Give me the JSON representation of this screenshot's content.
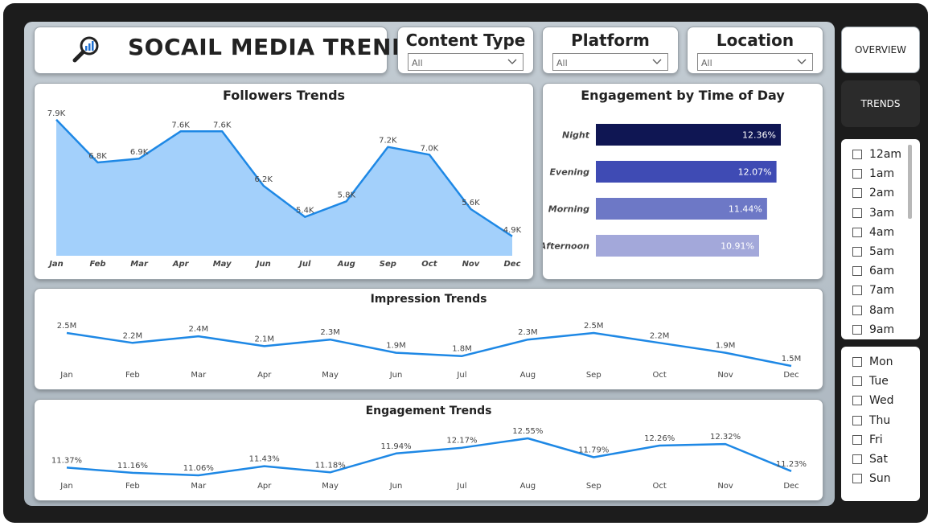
{
  "header": {
    "title": "SOCAIL MEDIA TRENDS",
    "icon": "magnifier-chart-icon"
  },
  "slicers": [
    {
      "label": "Content Type",
      "value": "All"
    },
    {
      "label": "Platform",
      "value": "All"
    },
    {
      "label": "Location",
      "value": "All"
    }
  ],
  "nav": {
    "overview": "OVERVIEW",
    "trends": "TRENDS"
  },
  "hours": [
    "12am",
    "1am",
    "2am",
    "3am",
    "4am",
    "5am",
    "6am",
    "7am",
    "8am",
    "9am"
  ],
  "days": [
    "Mon",
    "Tue",
    "Wed",
    "Thu",
    "Fri",
    "Sat",
    "Sun"
  ],
  "colors": {
    "line": "#1e88e5",
    "area": "#a3d0fb",
    "night": "#0f1653",
    "evening": "#3f4bb4",
    "morning": "#6d78c6",
    "afternoon": "#a3a8da"
  },
  "chart_data": [
    {
      "type": "area",
      "title": "Followers Trends",
      "categories": [
        "Jan",
        "Feb",
        "Mar",
        "Apr",
        "May",
        "Jun",
        "Jul",
        "Aug",
        "Sep",
        "Oct",
        "Nov",
        "Dec"
      ],
      "values": [
        7.9,
        6.8,
        6.9,
        7.6,
        7.6,
        6.2,
        5.4,
        5.8,
        7.2,
        7.0,
        5.6,
        4.9
      ],
      "labels": [
        "7.9K",
        "6.8K",
        "6.9K",
        "7.6K",
        "7.6K",
        "6.2K",
        "5.4K",
        "5.8K",
        "7.2K",
        "7.0K",
        "5.6K",
        "4.9K"
      ],
      "unit": "K",
      "ylim": [
        4.4,
        8.0
      ],
      "grid": false
    },
    {
      "type": "bar",
      "orientation": "horizontal",
      "title": "Engagement by Time of Day",
      "categories": [
        "Night",
        "Evening",
        "Morning",
        "Afternoon"
      ],
      "values": [
        12.36,
        12.07,
        11.44,
        10.91
      ],
      "labels": [
        "12.36%",
        "12.07%",
        "11.44%",
        "10.91%"
      ],
      "xlim": [
        0,
        12.36
      ]
    },
    {
      "type": "line",
      "title": "Impression Trends",
      "categories": [
        "Jan",
        "Feb",
        "Mar",
        "Apr",
        "May",
        "Jun",
        "Jul",
        "Aug",
        "Sep",
        "Oct",
        "Nov",
        "Dec"
      ],
      "values": [
        2.5,
        2.2,
        2.4,
        2.1,
        2.3,
        1.9,
        1.8,
        2.3,
        2.5,
        2.2,
        1.9,
        1.5
      ],
      "labels": [
        "2.5M",
        "2.2M",
        "2.4M",
        "2.1M",
        "2.3M",
        "1.9M",
        "1.8M",
        "2.3M",
        "2.5M",
        "2.2M",
        "1.9M",
        "1.5M"
      ],
      "unit": "M",
      "ylim": [
        1.5,
        2.5
      ]
    },
    {
      "type": "line",
      "title": "Engagement Trends",
      "categories": [
        "Jan",
        "Feb",
        "Mar",
        "Apr",
        "May",
        "Jun",
        "Jul",
        "Aug",
        "Sep",
        "Oct",
        "Nov",
        "Dec"
      ],
      "values": [
        11.37,
        11.16,
        11.06,
        11.43,
        11.18,
        11.94,
        12.17,
        12.55,
        11.79,
        12.26,
        12.32,
        11.23
      ],
      "labels": [
        "11.37%",
        "11.16%",
        "11.06%",
        "11.43%",
        "11.18%",
        "11.94%",
        "12.17%",
        "12.55%",
        "11.79%",
        "12.26%",
        "12.32%",
        "11.23%"
      ],
      "unit": "%",
      "ylim": [
        11.06,
        12.55
      ]
    }
  ]
}
